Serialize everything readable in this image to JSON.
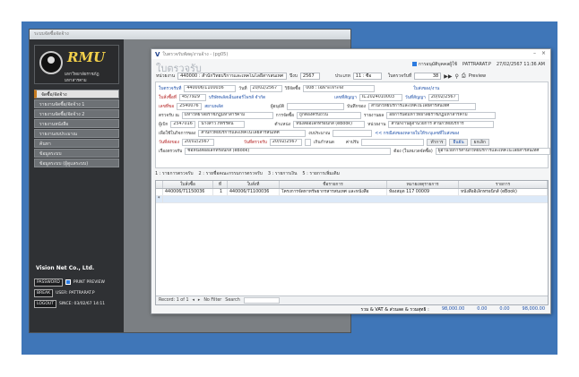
{
  "main_window": {
    "title": "ระบบจัดซื้อจัดจ้าง"
  },
  "logo": {
    "name": "RMU",
    "subtitle": "มหาวิทยาลัยราชภัฏมหาสารคาม"
  },
  "menu": [
    {
      "label": "จัดซื้อ/จัดจ้าง",
      "active": true
    },
    {
      "label": "รายงานจัดซื้อ/จัดจ้าง 1",
      "active": false
    },
    {
      "label": "รายงานจัดซื้อ/จัดจ้าง 2",
      "active": false
    },
    {
      "label": "รายงานหนังสือ",
      "active": false
    },
    {
      "label": "รายงานงบประมาณ",
      "active": false
    },
    {
      "label": "ค้นหา",
      "active": false
    },
    {
      "label": "ข้อมูลระบบ",
      "active": false
    },
    {
      "label": "ข้อมูลระบบ (ผู้ดูแลระบบ)",
      "active": false
    }
  ],
  "company": "Vision Net Co., Ltd.",
  "status": {
    "password_btn": "PASSWORD",
    "print_preview": "PRINT PREVIEW",
    "break_btn": "BREAK",
    "user": "USER: PATTRARAT.P",
    "logout_btn": "LOGOUT",
    "since": "SINCE: 03/02/67 14:11"
  },
  "form_window": {
    "title": "ใบตรวจรับพัสดุ/งานจ้าง - (pg05)",
    "header_title": "ใบตรวจรับ",
    "user_checkbox": "การอนุมัติบุคคลผู้ใช้",
    "user_name": "PATTRARAT.P",
    "datetime": "27/02/2567 11:36 AM",
    "agency_label": "หน่วยงาน",
    "agency_value": "440000 : สำนักวิทยบริการและเทคโนโลยีสารสนเทศ",
    "year_label": "ปีงบ",
    "year_value": "2567",
    "type_label": "ประเภท",
    "type_value": "11 : ซื้อ",
    "check_label": "ใบตรวจรับที่",
    "check_no": "38",
    "preview": "Preview"
  },
  "group": {
    "doc_no_label": "ใบตรวจรับที่",
    "doc_no": "440006/1100036",
    "date_label": "วันที่",
    "date": "20/02/2567",
    "method_label": "วิธีจัดซื้อ",
    "method": "008 : เฉพาะเจาะจง",
    "status_label": "ใบส่งของ/งาน",
    "po_label": "ใบสั่งซื้อที่",
    "po_no": "45/7929",
    "vendor": "บริษัทพลัสเอ็นเตอร์ไพรส์ จำกัด",
    "contract_label": "เลขที่สัญญา",
    "contract_no": "IL.2024010003",
    "contract_date_label": "วันที่สัญญา",
    "contract_date": "20/02/2567",
    "req_label": "เลขที่ขอ",
    "req_no": "2540076",
    "req_name": "สยามพลัส",
    "approve_label": "ผู้อนุมัติ",
    "record_label": "บันทึกของ",
    "record_value": "สำนักวิทยบริการและเทคโนโลยีสารสนเทศ",
    "plan_label": "ตรวจรับ ณ",
    "plan_value": "มหาวิทยาลัยราชภัฏมหาสารคาม",
    "type2_label": "การจัดซื้อ",
    "type2_value": "ถูกต้องครบถ้วน",
    "store_label": "รายงานผล",
    "store_value": "อธิการบดีมหาวิทยาลัยราชภัฏมหาสารคาม",
    "buyer_label": "ผู้เบิก",
    "buyer_no": "2547016",
    "buyer_name": "นางสาว ภัทรรัตน์",
    "item_label": "ตำแหน่ง",
    "item_value": "หนังสืออิเล็กทรอนิกส์ (eBook)",
    "dept_label": "หน่วยงาน",
    "dept_value": "สำนักงานผู้อำนวยการ สำนักวิทยบริการ",
    "purpose_label": "เพื่อใช้ในกิจการของ",
    "purpose_value": "สำนักวิทยบริการและเทคโนโลยีสารสนเทศ",
    "amount_label": "งบประมาณ",
    "doc_hint": "<< กรณีส่งของหลายใบให้ระบุเลขที่ใบส่งของ",
    "sent_date_label": "วันที่ส่งของ",
    "sent_date": "20/02/2567",
    "receive_date_label": "วันที่ตรวจรับ",
    "receive_date": "20/02/2567",
    "late_label": "เกินกำหนด",
    "fine_label": "ค่าปรับ",
    "receive_btn": "ทำการ",
    "cancel_btn": "ยกเลิก",
    "confirm_btn": "ยืนยัน",
    "note_label": "เรื่องตรวจรับ",
    "note_value": "ซื้อหนังสืออิเล็กทรอนิกส์ (eBook)",
    "remark_label": "ต้อง (ในหมวดจัดซื้อ)",
    "remark_value": "ผู้อำนวยการสำนักวิทยบริการและเทคโนโลยีสารสนเทศ"
  },
  "tabs": [
    "1 : รายการตรวจรับ",
    "2 : รายชื่อคณะกรรมการตรวจรับ",
    "3 : รายการเงิน",
    "5 : รายการเพิ่มเติม"
  ],
  "grid": {
    "columns": [
      "ใบสั่งซื้อ",
      "ที่",
      "ใบสั่งที่",
      "ชื่อรายการ",
      "หมายเหตุรายการ",
      "รายการ"
    ],
    "rows": [
      [
        "440006/71150036",
        "1",
        "440006/71100036",
        "โครงการจัดหาทรัพยากรสารสนเทศ และหนังสือ",
        "ห้องสมุด 117 00009",
        "หนังสืออิเล็กทรอนิกส์ (eBook)"
      ]
    ],
    "nav_text": "Record: 1 of 1",
    "no_filter": "No Filter",
    "search": "Search"
  },
  "totals": {
    "label": "รวม & VAT & ส่วนลด & รวมสุทธิ :",
    "amount": "98,000.00",
    "vat": "0.00",
    "discount": "0.00",
    "net": "98,000.00"
  }
}
